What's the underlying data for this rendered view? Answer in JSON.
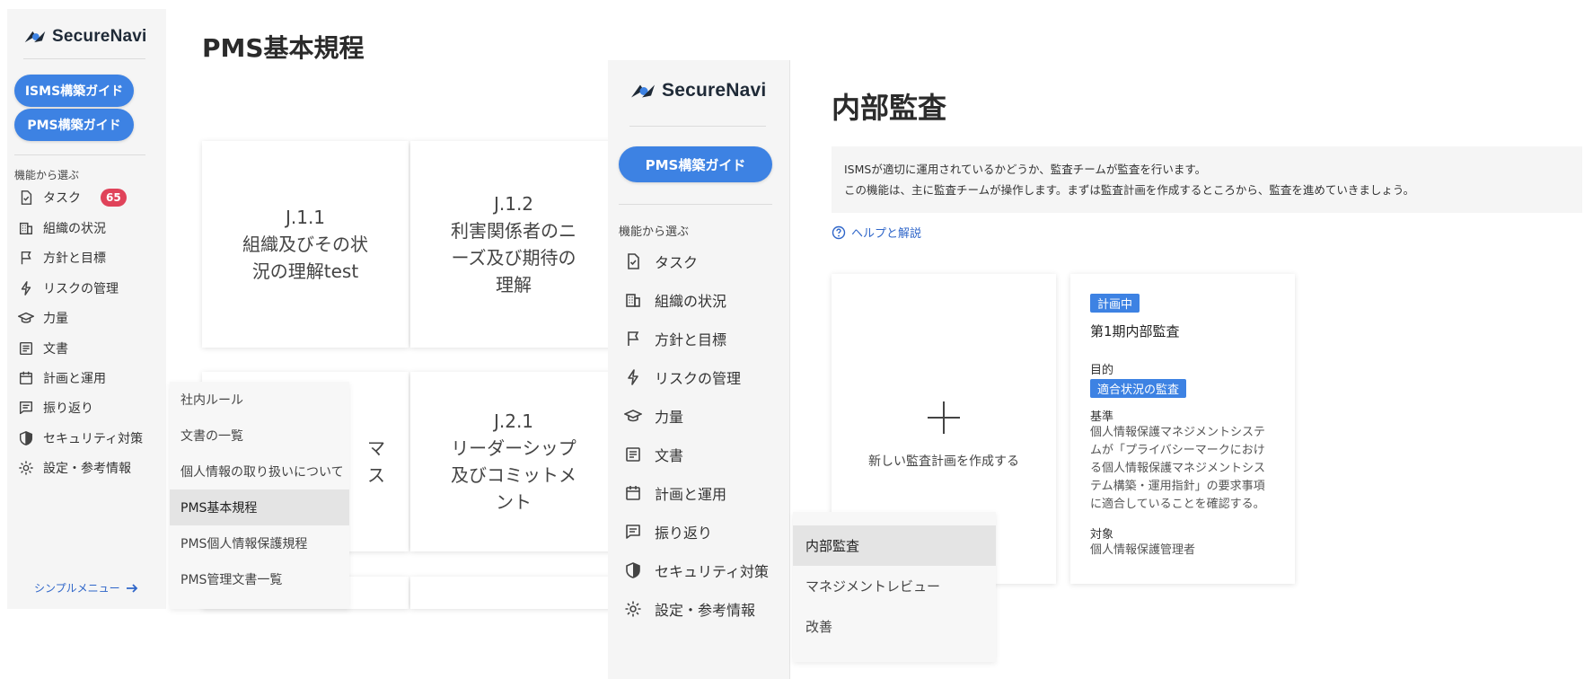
{
  "brand": {
    "name": "SecureNavi",
    "accent": "#3d82e3",
    "badge_color": "#e0435a"
  },
  "left_window": {
    "guide_buttons": [
      "ISMS構築ガイド",
      "PMS構築ガイド"
    ],
    "section_label": "機能から選ぶ",
    "nav": [
      {
        "icon": "task-icon",
        "label": "タスク",
        "badge": "65"
      },
      {
        "icon": "building-icon",
        "label": "組織の状況"
      },
      {
        "icon": "flag-icon",
        "label": "方針と目標"
      },
      {
        "icon": "lightning-icon",
        "label": "リスクの管理"
      },
      {
        "icon": "graduation-cap-icon",
        "label": "力量"
      },
      {
        "icon": "document-icon",
        "label": "文書"
      },
      {
        "icon": "calendar-icon",
        "label": "計画と運用"
      },
      {
        "icon": "review-icon",
        "label": "振り返り"
      },
      {
        "icon": "shield-icon",
        "label": "セキュリティ対策"
      },
      {
        "icon": "gear-icon",
        "label": "設定・参考情報"
      }
    ],
    "simple_menu": "シンプルメニュー",
    "page_title": "PMS基本規程",
    "cards": [
      {
        "code": "J.1.1",
        "title": "組織及びその状況の理解test"
      },
      {
        "code": "J.1.2",
        "title": "利害関係者のニーズ及び期待の理解"
      },
      {
        "code": "",
        "title": "マ ス"
      },
      {
        "code": "J.2.1",
        "title": "リーダーシップ及びコミットメント"
      }
    ],
    "flyout": [
      "社内ルール",
      "文書の一覧",
      "個人情報の取り扱いについて",
      "PMS基本規程",
      "PMS個人情報保護規程",
      "PMS管理文書一覧"
    ],
    "flyout_active": "PMS基本規程"
  },
  "right_window": {
    "guide_button": "PMS構築ガイド",
    "section_label": "機能から選ぶ",
    "nav": [
      {
        "icon": "task-icon",
        "label": "タスク"
      },
      {
        "icon": "building-icon",
        "label": "組織の状況"
      },
      {
        "icon": "flag-icon",
        "label": "方針と目標"
      },
      {
        "icon": "lightning-icon",
        "label": "リスクの管理"
      },
      {
        "icon": "graduation-cap-icon",
        "label": "力量"
      },
      {
        "icon": "document-icon",
        "label": "文書"
      },
      {
        "icon": "calendar-icon",
        "label": "計画と運用"
      },
      {
        "icon": "review-icon",
        "label": "振り返り"
      },
      {
        "icon": "shield-icon",
        "label": "セキュリティ対策"
      },
      {
        "icon": "gear-icon",
        "label": "設定・参考情報"
      }
    ],
    "page_title": "内部監査",
    "info_lines": [
      "ISMSが適切に運用されているかどうか、監査チームが監査を行います。",
      "この機能は、主に監査チームが操作します。まずは監査計画を作成するところから、監査を進めていきましょう。"
    ],
    "help_link": "ヘルプと解説",
    "new_plan_label": "新しい監査計画を作成する",
    "plan": {
      "status": "計画中",
      "name": "第1期内部監査",
      "purpose_label": "目的",
      "purpose_value": "適合状況の監査",
      "criteria_label": "基準",
      "criteria_value": "個人情報保護マネジメントシステムが「プライバシーマークにおける個人情報保護マネジメントシステム構築・運用指針」の要求事項に適合していることを確認する。",
      "target_label": "対象",
      "target_value": "個人情報保護管理者"
    },
    "flyout": [
      "内部監査",
      "マネジメントレビュー",
      "改善"
    ],
    "flyout_active": "内部監査"
  }
}
